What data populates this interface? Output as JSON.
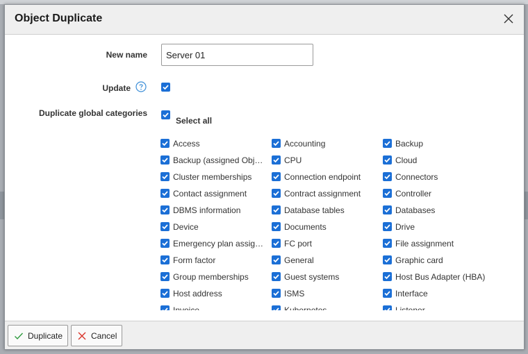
{
  "dialog": {
    "title": "Object Duplicate",
    "close_icon": "close-icon"
  },
  "form": {
    "new_name_label": "New name",
    "new_name_value": "Server 01",
    "update_label": "Update",
    "update_checked": true,
    "help_icon": "question-circle-icon",
    "categories_label": "Duplicate global categories",
    "select_all_label": "Select all",
    "select_all_checked": true
  },
  "categories": [
    [
      "Access",
      "Accounting",
      "Backup"
    ],
    [
      "Backup (assigned Obj…",
      "CPU",
      "Cloud"
    ],
    [
      "Cluster memberships",
      "Connection endpoint",
      "Connectors"
    ],
    [
      "Contact assignment",
      "Contract assignment",
      "Controller"
    ],
    [
      "DBMS information",
      "Database tables",
      "Databases"
    ],
    [
      "Device",
      "Documents",
      "Drive"
    ],
    [
      "Emergency plan assig…",
      "FC port",
      "File assignment"
    ],
    [
      "Form factor",
      "General",
      "Graphic card"
    ],
    [
      "Group memberships",
      "Guest systems",
      "Host Bus Adapter (HBA)"
    ],
    [
      "Host address",
      "ISMS",
      "Interface"
    ],
    [
      "Invoice",
      "Kubernetes",
      "Listener"
    ]
  ],
  "footer": {
    "duplicate_label": "Duplicate",
    "cancel_label": "Cancel",
    "duplicate_icon": "checkmark-icon",
    "cancel_icon": "x-icon"
  },
  "colors": {
    "checkbox": "#1b6fd6",
    "duplicate_icon": "#2e9a3e",
    "cancel_icon": "#d9342b",
    "help_icon": "#3d8fd8"
  }
}
